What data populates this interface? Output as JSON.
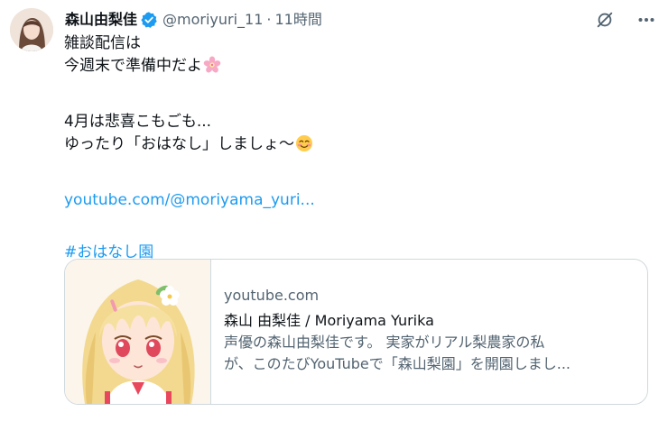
{
  "author": {
    "display_name": "森山由梨佳",
    "handle": "@moriyuri_11",
    "separator": "·",
    "time": "11時間",
    "avatar_icon": "user-avatar"
  },
  "header_actions": {
    "grok_icon": "grok-icon",
    "more_icon": "more-horizontal-icon"
  },
  "tweet": {
    "line1": "雑談配信は",
    "line2": "今週末で準備中だよ",
    "line3": "4月は悲喜こもごも...",
    "line4": "ゆったり「おはなし」しましょ〜",
    "link": "youtube.com/@moriyama_yuri...",
    "hashtag": "#おはなし園",
    "emoji1": "cherry-blossom-icon",
    "emoji2": "smiling-face-icon"
  },
  "card": {
    "domain": "youtube.com",
    "title": "森山 由梨佳 / Moriyama Yurika",
    "desc_line1": "声優の森山由梨佳です。 実家がリアル梨農家の私",
    "desc_line2": "が、このたびYouTubeで「森山梨園」を開園しまし..."
  },
  "colors": {
    "link": "#1d9bf0",
    "secondary_text": "#536471",
    "border": "#cfd9de",
    "verified": "#1d9bf0"
  }
}
